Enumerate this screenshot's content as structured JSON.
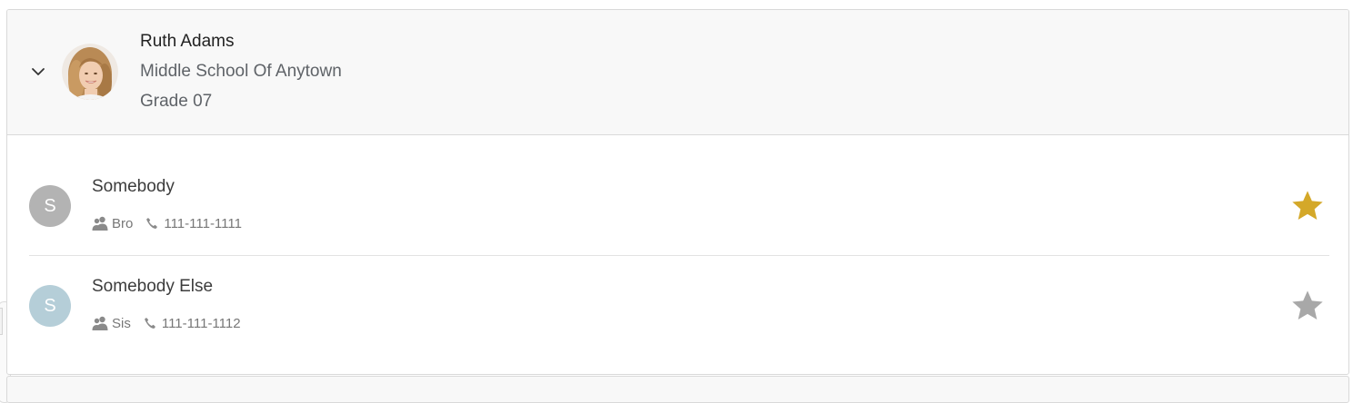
{
  "student": {
    "name": "Ruth Adams",
    "school": "Middle School Of Anytown",
    "grade": "Grade 07",
    "avatar_icon": "student-photo",
    "toggle_icon": "chevron-down-icon"
  },
  "contacts": [
    {
      "initial": "S",
      "name": "Somebody",
      "relationship": "Bro",
      "phone": "111-111-1111",
      "avatar_color": "#b3b3b3",
      "favorite": true,
      "star_color": "#d4a829"
    },
    {
      "initial": "S",
      "name": "Somebody Else",
      "relationship": "Sis",
      "phone": "111-111-1112",
      "avatar_color": "#b5ced8",
      "favorite": false,
      "star_color": "#a8a8a8"
    }
  ],
  "icons": {
    "relationship": "people-icon",
    "phone": "phone-icon",
    "favorite": "star-icon"
  }
}
